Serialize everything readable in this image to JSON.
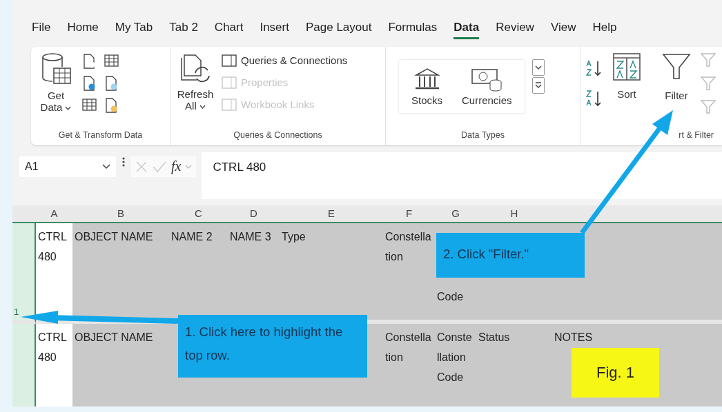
{
  "tabs": [
    {
      "label": "File",
      "selected": false
    },
    {
      "label": "Home",
      "selected": false
    },
    {
      "label": "My Tab",
      "selected": false
    },
    {
      "label": "Tab 2",
      "selected": false
    },
    {
      "label": "Chart",
      "selected": false
    },
    {
      "label": "Insert",
      "selected": false
    },
    {
      "label": "Page Layout",
      "selected": false
    },
    {
      "label": "Formulas",
      "selected": false
    },
    {
      "label": "Data",
      "selected": true
    },
    {
      "label": "Review",
      "selected": false
    },
    {
      "label": "View",
      "selected": false
    },
    {
      "label": "Help",
      "selected": false
    }
  ],
  "ribbon": {
    "get_transform": {
      "label": "Get & Transform Data",
      "get_data": "Get Data"
    },
    "queries": {
      "label": "Queries & Connections",
      "refresh": "Refresh All",
      "items": [
        {
          "label": "Queries & Connections",
          "disabled": false
        },
        {
          "label": "Properties",
          "disabled": true
        },
        {
          "label": "Workbook Links",
          "disabled": true
        }
      ]
    },
    "data_types": {
      "label": "Data Types",
      "items": [
        "Stocks",
        "Currencies"
      ]
    },
    "sort_filter": {
      "label": "rt & Filter",
      "sort": "Sort",
      "filter": "Filter"
    }
  },
  "formula_bar": {
    "name_box": "A1",
    "function_button": "fx",
    "formula": "CTRL 480"
  },
  "columns": [
    "A",
    "B",
    "C",
    "D",
    "E",
    "F",
    "G",
    "H"
  ],
  "rows": [
    {
      "header": "1",
      "cells": [
        "CTRL 480",
        "OBJECT NAME",
        "NAME 2",
        "NAME 3",
        "Type",
        "Constellation",
        "Code",
        null,
        null
      ]
    },
    {
      "cells": [
        "CTRL 480",
        "OBJECT NAME",
        null,
        null,
        null,
        "Constellation",
        "Constellation Code",
        "Status",
        "NOTES"
      ]
    }
  ],
  "callouts": [
    {
      "text": "1. Click here to highlight the top row."
    },
    {
      "text": "2. Click \"Filter.\""
    }
  ],
  "figure_label": "Fig. 1"
}
